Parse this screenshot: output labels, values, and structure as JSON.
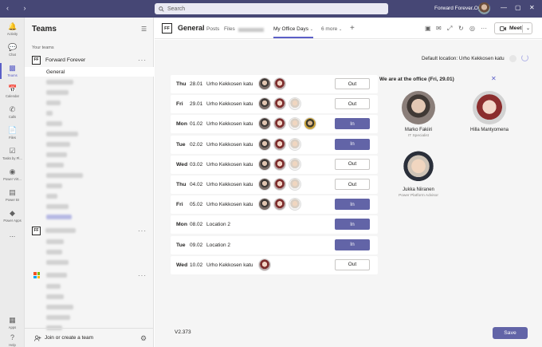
{
  "window": {
    "search_placeholder": "Search",
    "org_name": "Forward Forever Oy",
    "controls": [
      "…",
      "—",
      "▢",
      "✕"
    ]
  },
  "rail": [
    {
      "label": "Activity",
      "icon": "bell-icon"
    },
    {
      "label": "Chat",
      "icon": "chat-icon"
    },
    {
      "label": "Teams",
      "icon": "teams-icon",
      "active": true
    },
    {
      "label": "Calendar",
      "icon": "calendar-icon"
    },
    {
      "label": "Calls",
      "icon": "phone-icon"
    },
    {
      "label": "Files",
      "icon": "file-icon"
    },
    {
      "label": "Tasks by Pl...",
      "icon": "tasks-icon"
    },
    {
      "label": "Power Virt...",
      "icon": "power-virtual-agents-icon"
    },
    {
      "label": "Power BI",
      "icon": "power-bi-icon"
    },
    {
      "label": "Power Apps",
      "icon": "power-apps-icon"
    },
    {
      "label": "...",
      "icon": "more-icon"
    },
    {
      "label": "Apps",
      "icon": "apps-icon"
    },
    {
      "label": "Help",
      "icon": "help-icon"
    }
  ],
  "teams_panel": {
    "title": "Teams",
    "section_label": "Your teams",
    "team1_name": "Forward Forever",
    "team1_logo": "FF",
    "team2_logo": "FF",
    "active_channel": "General",
    "join_label": "Join or create a team"
  },
  "channel": {
    "logo": "FF",
    "name": "General",
    "tabs": {
      "posts": "Posts",
      "files": "Files",
      "office_days": "My Office Days",
      "more": "6 more"
    },
    "meet_label": "Meet"
  },
  "main": {
    "default_location": "Default location: Urho Kekkosen katu",
    "office_title": "We are at the office (Fri, 29.01)",
    "version": "V2.373",
    "save_label": "Save"
  },
  "days": [
    {
      "day": "Thu",
      "date": "28.01",
      "location": "Urho Kekkosen katu",
      "status": "Out",
      "attendees": [
        "marko",
        "hilla"
      ]
    },
    {
      "day": "Fri",
      "date": "29.01",
      "location": "Urho Kekkosen katu",
      "status": "Out",
      "attendees": [
        "marko",
        "hilla",
        "jukka"
      ]
    },
    {
      "day": "Mon",
      "date": "01.02",
      "location": "Urho Kekkosen katu",
      "status": "In",
      "attendees": [
        "marko",
        "hilla",
        "jukka",
        "four"
      ]
    },
    {
      "day": "Tue",
      "date": "02.02",
      "location": "Urho Kekkosen katu",
      "status": "In",
      "attendees": [
        "marko",
        "hilla",
        "jukka"
      ]
    },
    {
      "day": "Wed",
      "date": "03.02",
      "location": "Urho Kekkosen katu",
      "status": "Out",
      "attendees": [
        "marko",
        "hilla",
        "jukka"
      ]
    },
    {
      "day": "Thu",
      "date": "04.02",
      "location": "Urho Kekkosen katu",
      "status": "Out",
      "attendees": [
        "marko",
        "hilla",
        "jukka"
      ]
    },
    {
      "day": "Fri",
      "date": "05.02",
      "location": "Urho Kekkosen katu",
      "status": "In",
      "attendees": [
        "marko",
        "hilla",
        "jukka"
      ]
    },
    {
      "day": "Mon",
      "date": "08.02",
      "location": "Location 2",
      "status": "In",
      "attendees": []
    },
    {
      "day": "Tue",
      "date": "09.02",
      "location": "Location 2",
      "status": "In",
      "attendees": []
    },
    {
      "day": "Wed",
      "date": "10.02",
      "location": "Urho Kekkosen katu",
      "status": "Out",
      "attendees": [
        "hilla"
      ]
    }
  ],
  "people": [
    {
      "name": "Marko Fakiiri",
      "role": "IT Specialist"
    },
    {
      "name": "Hilla Mantyomena",
      "role": ""
    },
    {
      "name": "Jukka Niiranen",
      "role": "Power Platform Advisor"
    }
  ]
}
